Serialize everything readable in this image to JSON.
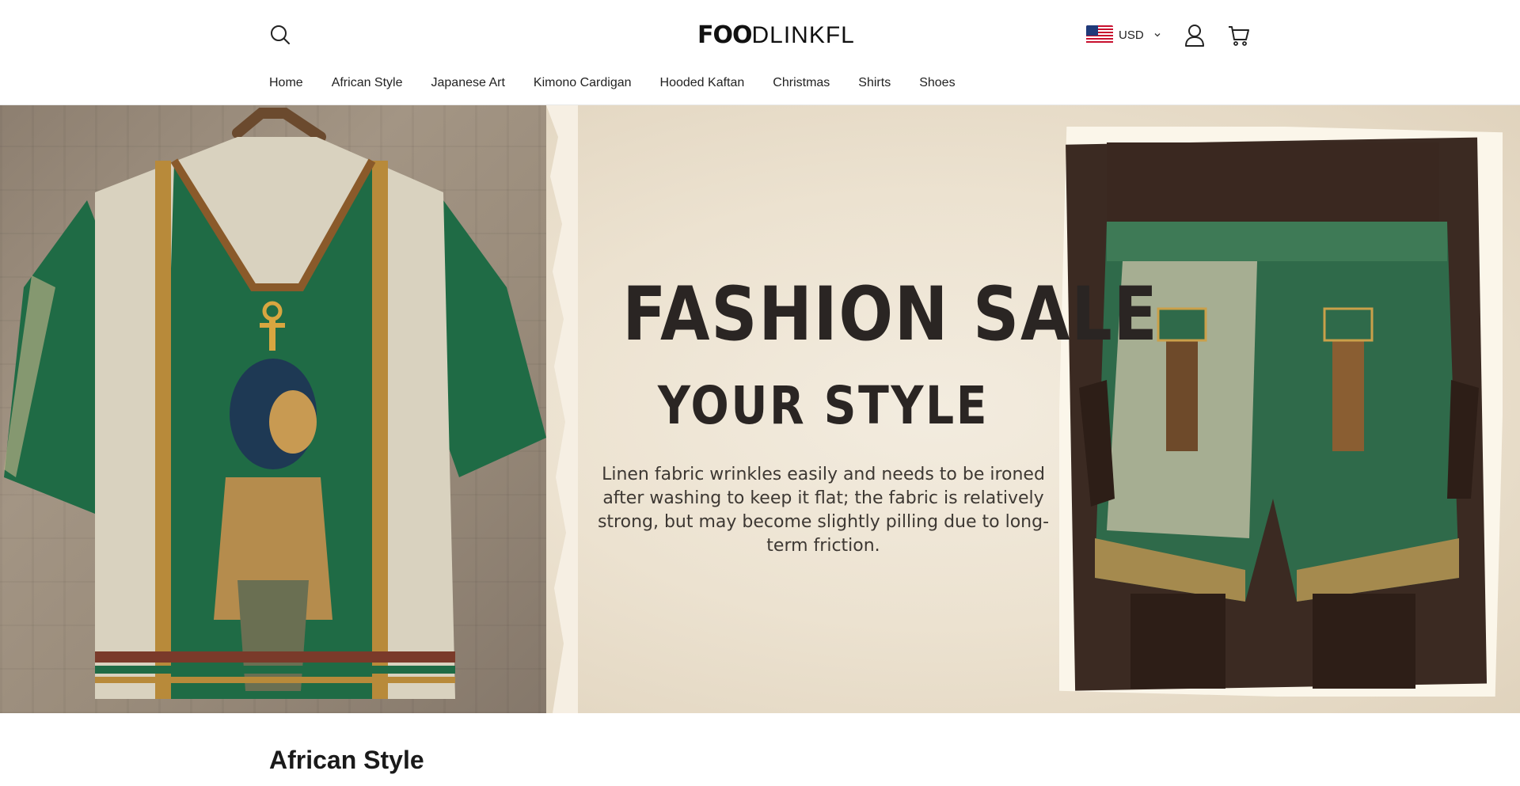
{
  "header": {
    "logo_bold": "FOO",
    "logo_light": "DLINKFL",
    "currency": "USD",
    "icons": [
      "search-icon",
      "us-flag-icon",
      "chevron-down-icon",
      "account-icon",
      "cart-icon"
    ]
  },
  "nav": {
    "items": [
      "Home",
      "African Style",
      "Japanese Art",
      "Kimono Cardigan",
      "Hooded Kaftan",
      "Christmas",
      "Shirts",
      "Shoes"
    ]
  },
  "banner": {
    "headline": "FASHION SALE",
    "subheadline": "YOUR STYLE",
    "tagline": "Linen fabric wrinkles easily and needs to be ironed after washing to keep it flat; the fabric is relatively strong, but may become slightly pilling due to long-term friction."
  },
  "section": {
    "title": "African Style"
  },
  "colors": {
    "text": "#1a1a1a",
    "banner_bg": "#ece2d0",
    "shirt_green": "#1f6b45",
    "headline": "#2a2523"
  }
}
